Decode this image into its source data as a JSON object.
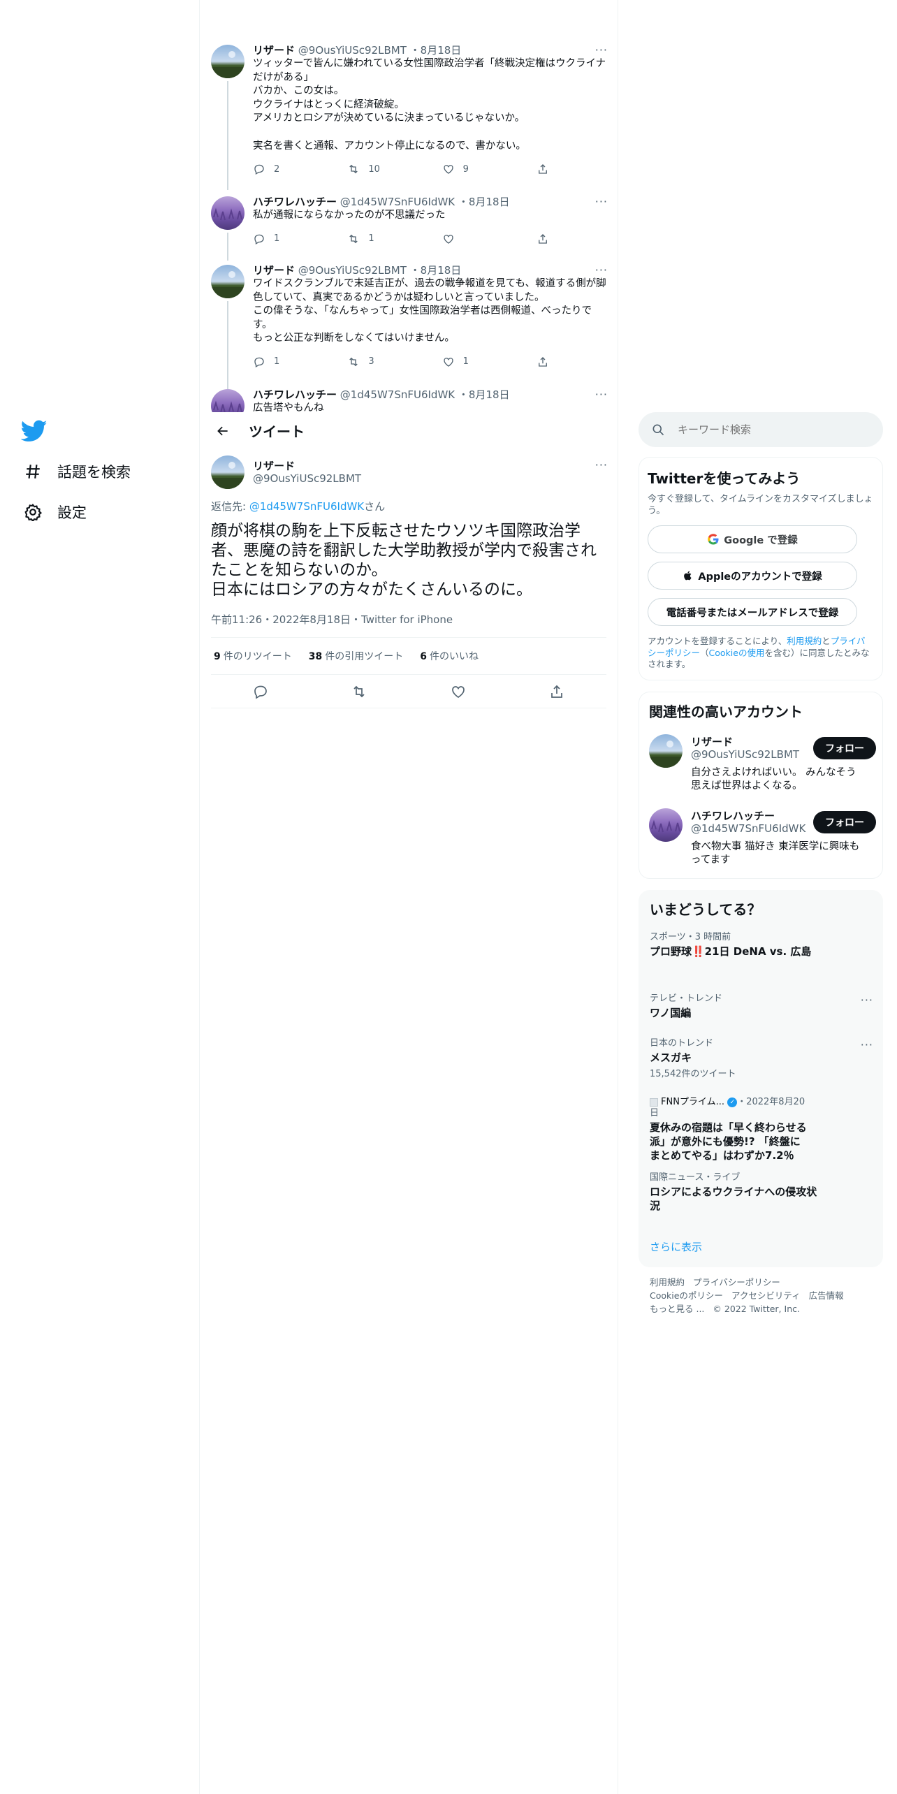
{
  "nav": {
    "items": [
      {
        "label": "話題を検索"
      },
      {
        "label": "設定"
      }
    ]
  },
  "thread": [
    {
      "name": "リザード",
      "handle": "@9OusYiUSc92LBMT",
      "date": "8月18日",
      "text": "ツィッターで皆んに嫌われている女性国際政治学者「終戦決定権はウクライナだけがある」\nバカか、この女は。\nウクライナはとっくに経済破綻。\nアメリカとロシアが決めているに決まっているじゃないか。\n\n実名を書くと通報、アカウント停止になるので、書かない。",
      "replies": "2",
      "retweets": "10",
      "likes": "9"
    },
    {
      "name": "ハチワレハッチー",
      "handle": "@1d45W7SnFU6IdWK",
      "date": "8月18日",
      "text": "私が通報にならなかったのが不思議だった",
      "replies": "1",
      "retweets": "1",
      "likes": ""
    },
    {
      "name": "リザード",
      "handle": "@9OusYiUSc92LBMT",
      "date": "8月18日",
      "text": "ワイドスクランブルで末延吉正が、過去の戦争報道を見ても、報道する側が脚色していて、真実であるかどうかは疑わしいと言っていました。\nこの偉そうな、「なんちゃって」女性国際政治学者は西側報道、べったりです。\nもっと公正な判断をしなくてはいけません。",
      "replies": "1",
      "retweets": "3",
      "likes": "1"
    },
    {
      "name": "ハチワレハッチー",
      "handle": "@1d45W7SnFU6IdWK",
      "date": "8月18日",
      "text": "広告塔やもんね"
    }
  ],
  "detail": {
    "header_title": "ツイート",
    "name": "リザード",
    "handle": "@9OusYiUSc92LBMT",
    "reply_prefix": "返信先: ",
    "reply_to": "@1d45W7SnFU6IdWK",
    "reply_suffix": "さん",
    "text": "顔が将棋の駒を上下反転させたウソツキ国際政治学者、悪魔の詩を翻訳した大学助教授が学内で殺害されたことを知らないのか。\n日本にはロシアの方々がたくさんいるのに。",
    "meta": "午前11:26・2022年8月18日・Twitter for iPhone",
    "retweets_count": "9",
    "retweets_label": "件のリツイート",
    "quotes_count": "38",
    "quotes_label": "件の引用ツイート",
    "likes_count": "6",
    "likes_label": "件のいいね"
  },
  "search": {
    "placeholder": "キーワード検索"
  },
  "signup": {
    "title": "Twitterを使ってみよう",
    "subtitle": "今すぐ登録して、タイムラインをカスタマイズしましょう。",
    "google_label": "Google で登録",
    "apple_label": "Appleのアカウントで登録",
    "phone_label": "電話番号またはメールアドレスで登録",
    "legal_1": "アカウントを登録することにより、",
    "legal_terms": "利用規約",
    "legal_and": "と",
    "legal_privacy": "プライバシーポリシー",
    "legal_paren_open": "（",
    "legal_cookie": "Cookieの使用",
    "legal_2": "を含む）に同意したとみなされます。"
  },
  "related": {
    "title": "関連性の高いアカウント",
    "accounts": [
      {
        "name": "リザード",
        "handle": "@9OusYiUSc92LBMT",
        "bio": "自分さえよければいい。 みんなそう思えば世界はよくなる。",
        "follow": "フォロー"
      },
      {
        "name": "ハチワレハッチー",
        "handle": "@1d45W7SnFU6IdWK",
        "bio": "食べ物大事 猫好き 東洋医学に興味もってます",
        "follow": "フォロー"
      }
    ]
  },
  "trends": {
    "title": "いまどうしてる？",
    "items": [
      {
        "meta": "スポーツ・3 時間前",
        "title": "プロ野球‼️21日 DeNA vs. 広島"
      },
      {
        "meta": "テレビ・トレンド",
        "title": "ワノ国編"
      },
      {
        "meta": "日本のトレンド",
        "title": "メスガキ",
        "count": "15,542件のツイート"
      },
      {
        "meta_source": "FNNプライム...",
        "meta_date": "・2022年8月20日",
        "title": "夏休みの宿題は「早く終わらせる派」が意外にも優勢!? 「終盤にまとめてやる」はわずか7.2％"
      },
      {
        "meta": "国際ニュース・ライブ",
        "title": "ロシアによるウクライナへの侵攻状況"
      }
    ],
    "show_more": "さらに表示"
  },
  "footer": {
    "line1": [
      "利用規約",
      "プライバシーポリシー"
    ],
    "line2": [
      "Cookieのポリシー",
      "アクセシビリティ",
      "広告情報"
    ],
    "more": "もっと見る ...",
    "copyright": "© 2022 Twitter, Inc."
  },
  "colors": {
    "accent": "#1d9bf0",
    "text": "#0f1419",
    "muted": "#536471",
    "border": "#eff3f4"
  }
}
